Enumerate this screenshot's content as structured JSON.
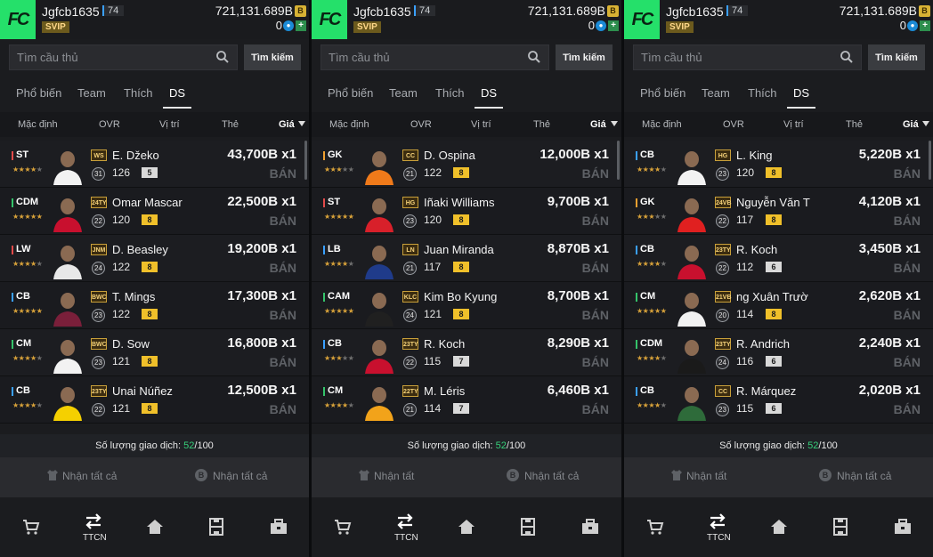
{
  "panels": [
    {
      "user": {
        "name": "Jgfcb1635",
        "level": "74",
        "vip": "SVIP",
        "coins": "721,131.689B",
        "coin_icon": "B",
        "fc": "0"
      },
      "search": {
        "placeholder": "Tìm cầu thủ",
        "button": "Tìm kiếm"
      },
      "tabs": [
        "Phổ biến",
        "Team",
        "Thích",
        "DS"
      ],
      "sort": [
        "Mặc định",
        "OVR",
        "Vị trí",
        "Thẻ",
        "Giá"
      ],
      "rows": [
        {
          "pos": "ST",
          "pos_color": "#e24a4a",
          "stars": 4,
          "badge": "WS",
          "ovr_circle": "31",
          "name": "E. Džeko",
          "ovr": "126",
          "level": "5",
          "level_color": "#d9d9d9",
          "price": "43,700B x1",
          "sell": "BÁN",
          "kit": "#f2f2f2"
        },
        {
          "pos": "CDM",
          "pos_color": "#34c36a",
          "stars": 5,
          "badge": "24TY",
          "ovr_circle": "22",
          "name": "Omar Mascar",
          "ovr": "120",
          "level": "8",
          "level_color": "#f0c02a",
          "price": "22,500B x1",
          "sell": "BÁN",
          "kit": "#c8102e"
        },
        {
          "pos": "LW",
          "pos_color": "#e24a4a",
          "stars": 4,
          "badge": "JNM",
          "ovr_circle": "24",
          "name": "D. Beasley",
          "ovr": "122",
          "level": "8",
          "level_color": "#f0c02a",
          "price": "19,200B x1",
          "sell": "BÁN",
          "kit": "#e8e8e8"
        },
        {
          "pos": "CB",
          "pos_color": "#3aa0ff",
          "stars": 5,
          "badge": "BWC",
          "ovr_circle": "23",
          "name": "T. Mings",
          "ovr": "122",
          "level": "8",
          "level_color": "#f0c02a",
          "price": "17,300B x1",
          "sell": "BÁN",
          "kit": "#7a1f3a"
        },
        {
          "pos": "CM",
          "pos_color": "#34c36a",
          "stars": 4,
          "badge": "BWC",
          "ovr_circle": "23",
          "name": "D. Sow",
          "ovr": "121",
          "level": "8",
          "level_color": "#f0c02a",
          "price": "16,800B x1",
          "sell": "BÁN",
          "kit": "#f2f2f2"
        },
        {
          "pos": "CB",
          "pos_color": "#3aa0ff",
          "stars": 4,
          "badge": "23TY",
          "ovr_circle": "22",
          "name": "Unai Núñez",
          "ovr": "121",
          "level": "8",
          "level_color": "#f0c02a",
          "price": "12,500B x1",
          "sell": "BÁN",
          "kit": "#f5d000"
        }
      ],
      "trade": {
        "label": "Số lượng giao dịch: ",
        "count": "52",
        "total": "/100"
      },
      "claims": [
        "Nhận tất cả",
        "Nhận tất cả"
      ],
      "nav": {
        "active_label": "TTCN"
      }
    },
    {
      "user": {
        "name": "Jgfcb1635",
        "level": "74",
        "vip": "SVIP",
        "coins": "721,131.689B",
        "coin_icon": "B",
        "fc": "0"
      },
      "search": {
        "placeholder": "Tìm cầu thủ",
        "button": "Tìm kiếm"
      },
      "tabs": [
        "Phổ biến",
        "Team",
        "Thích",
        "DS"
      ],
      "sort": [
        "Mặc định",
        "OVR",
        "Vị trí",
        "Thẻ",
        "Giá"
      ],
      "rows": [
        {
          "pos": "GK",
          "pos_color": "#f0a030",
          "stars": 3,
          "badge": "CC",
          "ovr_circle": "21",
          "name": "D. Ospina",
          "ovr": "122",
          "level": "8",
          "level_color": "#f0c02a",
          "price": "12,000B x1",
          "sell": "BÁN",
          "kit": "#f07a1a"
        },
        {
          "pos": "ST",
          "pos_color": "#e24a4a",
          "stars": 5,
          "badge": "HG",
          "ovr_circle": "23",
          "name": "Iñaki Williams",
          "ovr": "120",
          "level": "8",
          "level_color": "#f0c02a",
          "price": "9,700B x1",
          "sell": "BÁN",
          "kit": "#d8202a"
        },
        {
          "pos": "LB",
          "pos_color": "#3aa0ff",
          "stars": 4,
          "badge": "LN",
          "ovr_circle": "21",
          "name": "Juan Miranda",
          "ovr": "117",
          "level": "8",
          "level_color": "#f0c02a",
          "price": "8,870B x1",
          "sell": "BÁN",
          "kit": "#1f3b8a"
        },
        {
          "pos": "CAM",
          "pos_color": "#34c36a",
          "stars": 5,
          "badge": "KLC",
          "ovr_circle": "24",
          "name": "Kim Bo Kyung",
          "ovr": "121",
          "level": "8",
          "level_color": "#f0c02a",
          "price": "8,700B x1",
          "sell": "BÁN",
          "kit": "#202020"
        },
        {
          "pos": "CB",
          "pos_color": "#3aa0ff",
          "stars": 3,
          "badge": "23TY",
          "ovr_circle": "22",
          "name": "R. Koch",
          "ovr": "115",
          "level": "7",
          "level_color": "#d9d9d9",
          "price": "8,290B x1",
          "sell": "BÁN",
          "kit": "#c8102e"
        },
        {
          "pos": "CM",
          "pos_color": "#34c36a",
          "stars": 4,
          "badge": "22TY",
          "ovr_circle": "21",
          "name": "M. Léris",
          "ovr": "114",
          "level": "7",
          "level_color": "#d9d9d9",
          "price": "6,460B x1",
          "sell": "BÁN",
          "kit": "#f2a31a"
        }
      ],
      "trade": {
        "label": "Số lượng giao dịch: ",
        "count": "52",
        "total": "/100"
      },
      "claims": [
        "Nhận tất",
        "Nhận tất cả"
      ],
      "nav": {
        "active_label": "TTCN"
      }
    },
    {
      "user": {
        "name": "Jgfcb1635",
        "level": "74",
        "vip": "SVIP",
        "coins": "721,131.689B",
        "coin_icon": "B",
        "fc": "0"
      },
      "search": {
        "placeholder": "Tìm cầu thủ",
        "button": "Tìm kiếm"
      },
      "tabs": [
        "Phổ biến",
        "Team",
        "Thích",
        "DS"
      ],
      "sort": [
        "Mặc định",
        "OVR",
        "Vị trí",
        "Thẻ",
        "Giá"
      ],
      "rows": [
        {
          "pos": "CB",
          "pos_color": "#3aa0ff",
          "stars": 4,
          "badge": "HG",
          "ovr_circle": "23",
          "name": "L. King",
          "ovr": "120",
          "level": "8",
          "level_color": "#f0c02a",
          "price": "5,220B x1",
          "sell": "BÁN",
          "kit": "#f2f2f2"
        },
        {
          "pos": "GK",
          "pos_color": "#f0a030",
          "stars": 3,
          "badge": "24VB",
          "ovr_circle": "22",
          "name": "Nguyễn Văn T",
          "ovr": "117",
          "level": "8",
          "level_color": "#f0c02a",
          "price": "4,120B x1",
          "sell": "BÁN",
          "kit": "#e02020"
        },
        {
          "pos": "CB",
          "pos_color": "#3aa0ff",
          "stars": 4,
          "badge": "23TY",
          "ovr_circle": "22",
          "name": "R. Koch",
          "ovr": "112",
          "level": "6",
          "level_color": "#d9d9d9",
          "price": "3,450B x1",
          "sell": "BÁN",
          "kit": "#c8102e"
        },
        {
          "pos": "CM",
          "pos_color": "#34c36a",
          "stars": 5,
          "badge": "21VB",
          "ovr_circle": "20",
          "name": "ng Xuân Trườ",
          "ovr": "114",
          "level": "8",
          "level_color": "#f0c02a",
          "price": "2,620B x1",
          "sell": "BÁN",
          "kit": "#f2f2f2"
        },
        {
          "pos": "CDM",
          "pos_color": "#34c36a",
          "stars": 4,
          "badge": "23TY",
          "ovr_circle": "24",
          "name": "R. Andrich",
          "ovr": "116",
          "level": "6",
          "level_color": "#d9d9d9",
          "price": "2,240B x1",
          "sell": "BÁN",
          "kit": "#1a1a1a"
        },
        {
          "pos": "CB",
          "pos_color": "#3aa0ff",
          "stars": 4,
          "badge": "CC",
          "ovr_circle": "23",
          "name": "R. Márquez",
          "ovr": "115",
          "level": "6",
          "level_color": "#d9d9d9",
          "price": "2,020B x1",
          "sell": "BÁN",
          "kit": "#2e6b3a"
        }
      ],
      "trade": {
        "label": "Số lượng giao dịch: ",
        "count": "52",
        "total": "/100"
      },
      "claims": [
        "Nhận tất",
        "Nhận tất cả"
      ],
      "nav": {
        "active_label": "TTCN"
      }
    }
  ]
}
